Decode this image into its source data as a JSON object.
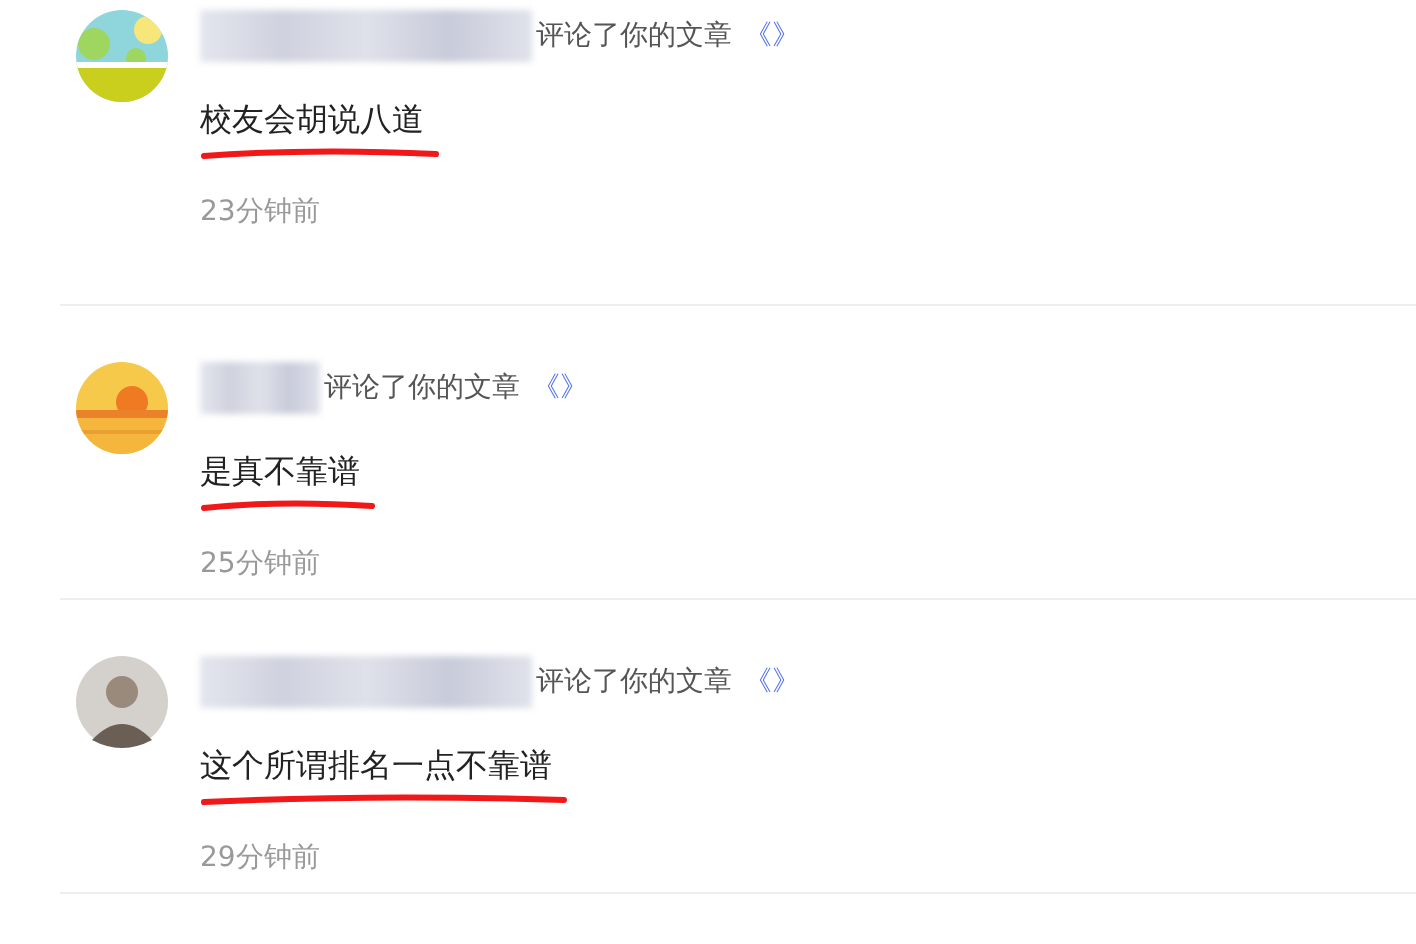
{
  "notifications": [
    {
      "avatar": {
        "kind": "landscape"
      },
      "redacted_name": {
        "kind": "long"
      },
      "action": "评论了你的文章",
      "article_title": "《》",
      "comment": "校友会胡说八道",
      "time": "23分钟前"
    },
    {
      "avatar": {
        "kind": "sunset"
      },
      "redacted_name": {
        "kind": "short"
      },
      "action": "评论了你的文章",
      "article_title": "《》",
      "comment": "是真不靠谱",
      "time": "25分钟前"
    },
    {
      "avatar": {
        "kind": "photo"
      },
      "redacted_name": {
        "kind": "long"
      },
      "action": "评论了你的文章",
      "article_title": "《》",
      "comment": "这个所谓排名一点不靠谱",
      "time": "29分钟前"
    }
  ]
}
